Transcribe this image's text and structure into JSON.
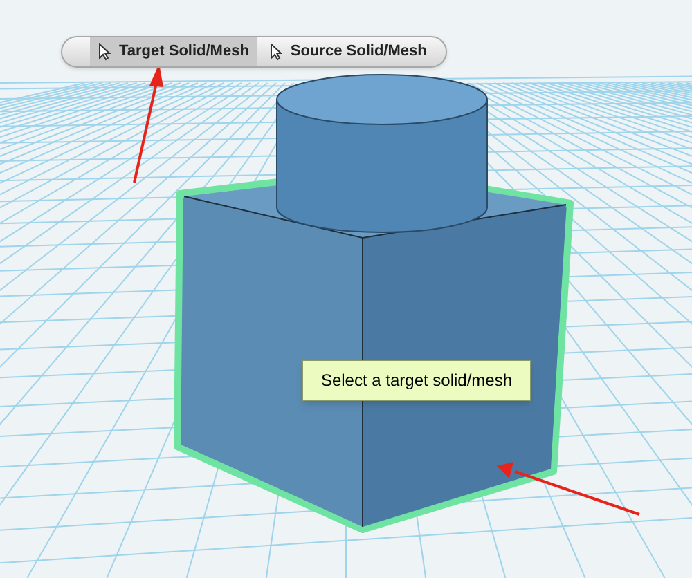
{
  "toolbar": {
    "buttons": [
      {
        "label": "Target Solid/Mesh",
        "selected": true
      },
      {
        "label": "Source Solid/Mesh",
        "selected": false
      }
    ]
  },
  "tooltip": {
    "text": "Select a target solid/mesh"
  }
}
